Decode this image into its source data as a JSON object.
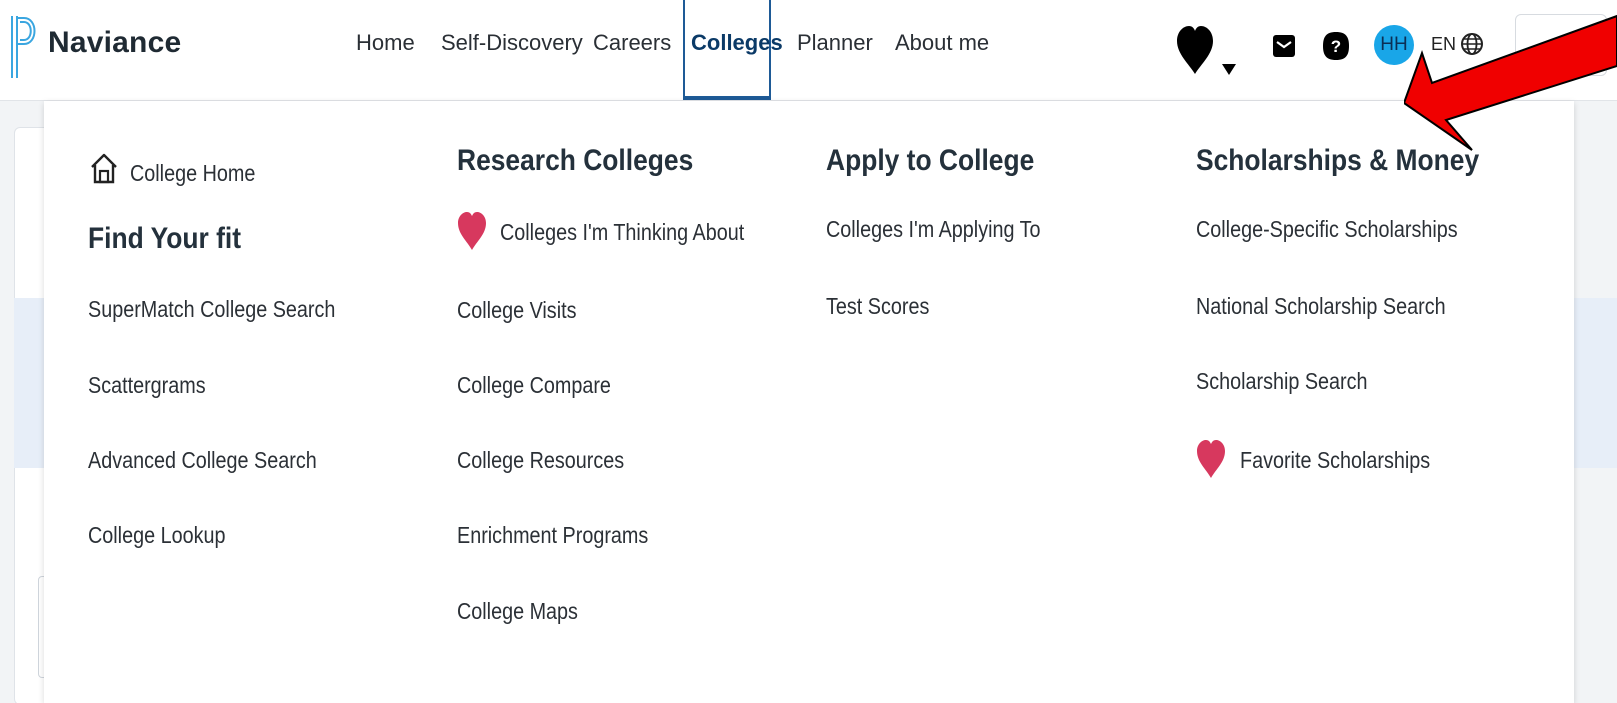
{
  "app": {
    "brand": "Naviance"
  },
  "nav": {
    "items": [
      {
        "label": "Home"
      },
      {
        "label": "Self-Discovery"
      },
      {
        "label": "Careers"
      },
      {
        "label": "Colleges",
        "active": true
      },
      {
        "label": "Planner"
      },
      {
        "label": "About me"
      }
    ],
    "avatar_initials": "HH",
    "language": "EN",
    "icons": [
      "heart-icon",
      "chevron-down-icon",
      "mail-icon",
      "help-icon",
      "globe-icon"
    ]
  },
  "menu": {
    "home_link": "College Home",
    "columns": [
      {
        "heading": "Find Your fit",
        "links": [
          "SuperMatch College Search",
          "Scattergrams",
          "Advanced College Search",
          "College Lookup"
        ]
      },
      {
        "heading": "Research Colleges",
        "favorite_link": "Colleges I'm Thinking About",
        "links": [
          "College Visits",
          "College Compare",
          "College Resources",
          "Enrichment Programs",
          "College Maps"
        ]
      },
      {
        "heading": "Apply to College",
        "links": [
          "Colleges I'm Applying To",
          "Test Scores"
        ]
      },
      {
        "heading": "Scholarships & Money",
        "links": [
          "College-Specific Scholarships",
          "National Scholarship Search",
          "Scholarship Search"
        ],
        "favorite_link": "Favorite Scholarships"
      }
    ]
  },
  "colors": {
    "accent": "#1e5a96",
    "avatar": "#19a6e8",
    "heart": "#d7385e",
    "annotation_arrow": "#f00000"
  }
}
